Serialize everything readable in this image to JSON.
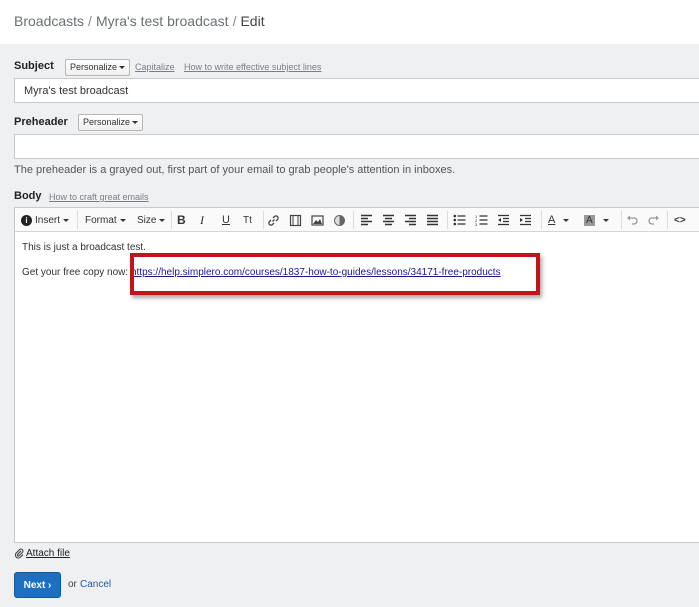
{
  "breadcrumb": {
    "items": [
      "Broadcasts",
      "Myra's test broadcast"
    ],
    "current": "Edit",
    "separator": "/"
  },
  "subject": {
    "label": "Subject",
    "personalize": "Personalize",
    "capitalize": "Capitalize",
    "help": "How to write effective subject lines",
    "value": "Myra's test broadcast"
  },
  "preheader": {
    "label": "Preheader",
    "personalize": "Personalize",
    "value": "",
    "hint": "The preheader is a grayed out, first part of your email to grab people's attention in inboxes."
  },
  "body": {
    "label": "Body",
    "help": "How to craft great emails",
    "toolbar": {
      "insert": "Insert",
      "format": "Format",
      "size": "Size",
      "bold": "B",
      "italic": "I",
      "underline": "U",
      "font_size": "Tt",
      "text_color": "A",
      "bg_color": "A",
      "source": "<>"
    },
    "line1": "This is just a broadcast test.",
    "line2_prefix": "Get your free copy now:",
    "link": "https://help.simplero.com/courses/1837-how-to-guides/lessons/34171-free-products"
  },
  "attach_label": "Attach file",
  "actions": {
    "next": "Next ›",
    "or": "or",
    "cancel": "Cancel"
  },
  "colors": {
    "primary": "#1e6fbf",
    "highlight": "#c2151b",
    "background": "#eef0f2"
  }
}
